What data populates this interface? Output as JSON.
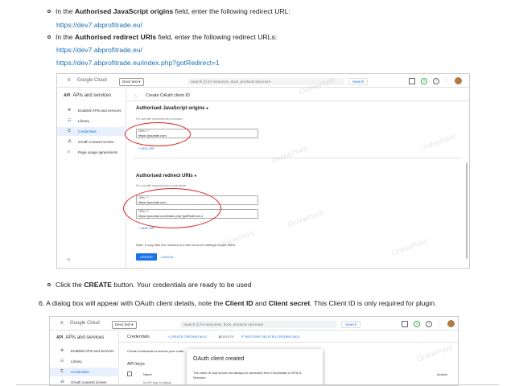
{
  "doc": {
    "line1": {
      "prefix": "In the ",
      "bold": "Authorised JavaScript origins",
      "suffix": " field, enter the following redirect URL:"
    },
    "url1": "https://dev7.abprofitrade.eu/",
    "line2": {
      "prefix": "In the ",
      "bold": "Authorised redirect URIs",
      "suffix": " field, enter the following redirect URLs:"
    },
    "url2": "https://dev7.abprofitrade.eu/",
    "url3": "https://dev7.abprofitrade.eu/index.php?gotRedirect=1",
    "line3": {
      "prefix": "Click the ",
      "bold": "CREATE",
      "suffix": " button. Your credentials are ready to be used"
    },
    "step6": {
      "num": "6.",
      "a": "A dialog box will appear with OAuth client details, note the ",
      "b1": "Client ID",
      "c": " and ",
      "b2": "Client secret",
      "d": ". This Client ID is only required for plugin."
    }
  },
  "shot1": {
    "logo": "Google Cloud",
    "project": "Dev2 test ▾",
    "search_placeholder": "Search (/) for resources, docs, products and more",
    "search_button": "Search",
    "badge": "9",
    "api_title": "APIs and services",
    "sidebar": [
      {
        "icon": "✥",
        "label": "Enabled APIs and services"
      },
      {
        "icon": "☷",
        "label": "Library"
      },
      {
        "icon": "⚿",
        "label": "Credentials"
      },
      {
        "icon": "⁂",
        "label": "OAuth consent screen"
      },
      {
        "icon": "≡",
        "label": "Page usage agreements"
      }
    ],
    "collapse": "<|",
    "back": "←",
    "page_title": "Create OAuth client ID",
    "origins_title": "Authorised JavaScript origins",
    "origins_hint": "For use with requests from a browser",
    "uri1_label": "URIs 1 *",
    "uri1_value": "https://yoursite.com",
    "add_uri": "+ ADD URI",
    "redirect_title": "Authorised redirect URIs",
    "redirect_hint": "For use with requests from a web server",
    "r1_label": "URIs 1 *",
    "r1_value": "https://yoursite.com",
    "r2_label": "URIs 2 *",
    "r2_value": "https://yoursite.com/index.php?gotRedirect=1",
    "note": "Note: It may take five minutes to a few hours for settings to take effect",
    "create": "CREATE",
    "cancel": "CANCEL"
  },
  "shot2": {
    "logo": "Google Cloud",
    "project": "Dev2 test ▾",
    "search_placeholder": "Search (/) for resources, docs, products and more",
    "search_button": "Search",
    "badge": "9",
    "api_title": "APIs and services",
    "credentials_title": "Credentials",
    "create_credentials": "+ CREATE CREDENTIALS",
    "delete": "DELETE",
    "restore": "RESTORE DELETED CREDENTIALS",
    "sidebar": [
      {
        "icon": "✥",
        "label": "Enabled APIs and services"
      },
      {
        "icon": "☷",
        "label": "Library"
      },
      {
        "icon": "⚿",
        "label": "Credentials"
      },
      {
        "icon": "⁂",
        "label": "OAuth consent screen"
      }
    ],
    "create_cred_hint": "Create credentials to access your enabl",
    "api_keys": "API keys",
    "col_name": "Name",
    "no_api": "No API keys to display",
    "col_actions": "Actions",
    "dialog_title": "OAuth client created",
    "dialog_text": "The client ID and secret can always be accessed from Credentials in APIs & Services"
  },
  "watermark": "OnlinePoint"
}
